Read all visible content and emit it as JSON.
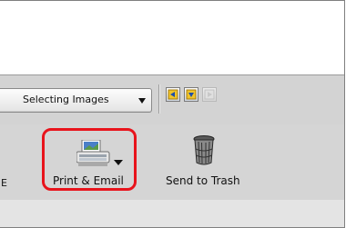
{
  "toolbar": {
    "dropdown_value": "Selecting Images",
    "nav_buttons": [
      {
        "icon": "arrow-left-icon",
        "enabled": true
      },
      {
        "icon": "arrow-down-icon",
        "enabled": true
      },
      {
        "icon": "arrow-right-icon",
        "enabled": false
      }
    ]
  },
  "actions": {
    "cut_label": "E",
    "print_email_label": "Print & Email",
    "send_to_trash_label": "Send to Trash",
    "highlight_color": "#e8141c"
  }
}
